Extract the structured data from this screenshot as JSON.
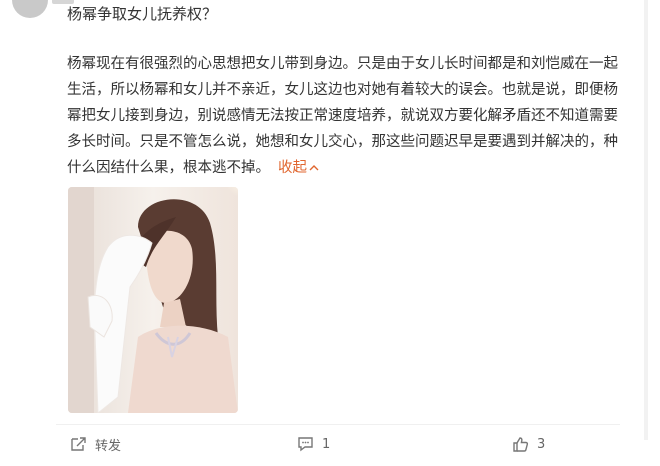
{
  "post": {
    "question": "杨幂争取女儿抚养权？",
    "answer_lines": [
      "杨幂现在有很强烈的心思想把女儿带到身边。只是由于女儿长时间都是和刘恺威在一起",
      "生活，所以杨幂和女儿并不亲近，女儿这边也对她有着较大的误会。也就是说，即便杨",
      "幂把女儿接到身边，别说感情无法按正常速度培养，就说双方要化解矛盾还不知道需要",
      "多长时间。只是不管怎么说，她想和女儿交心，那这些问题迟早是要遇到并解决的，种",
      "什么因结什么果，根本逃不掉。"
    ],
    "collapse_label": "收起",
    "collapse_icon": "chevron-up-icon",
    "accent_color": "#e0662f"
  },
  "actions": {
    "repost_label": "转发",
    "repost_icon": "repost-icon",
    "comment_count": "1",
    "comment_icon": "comment-icon",
    "like_count": "3",
    "like_icon": "thumbs-up-icon"
  }
}
